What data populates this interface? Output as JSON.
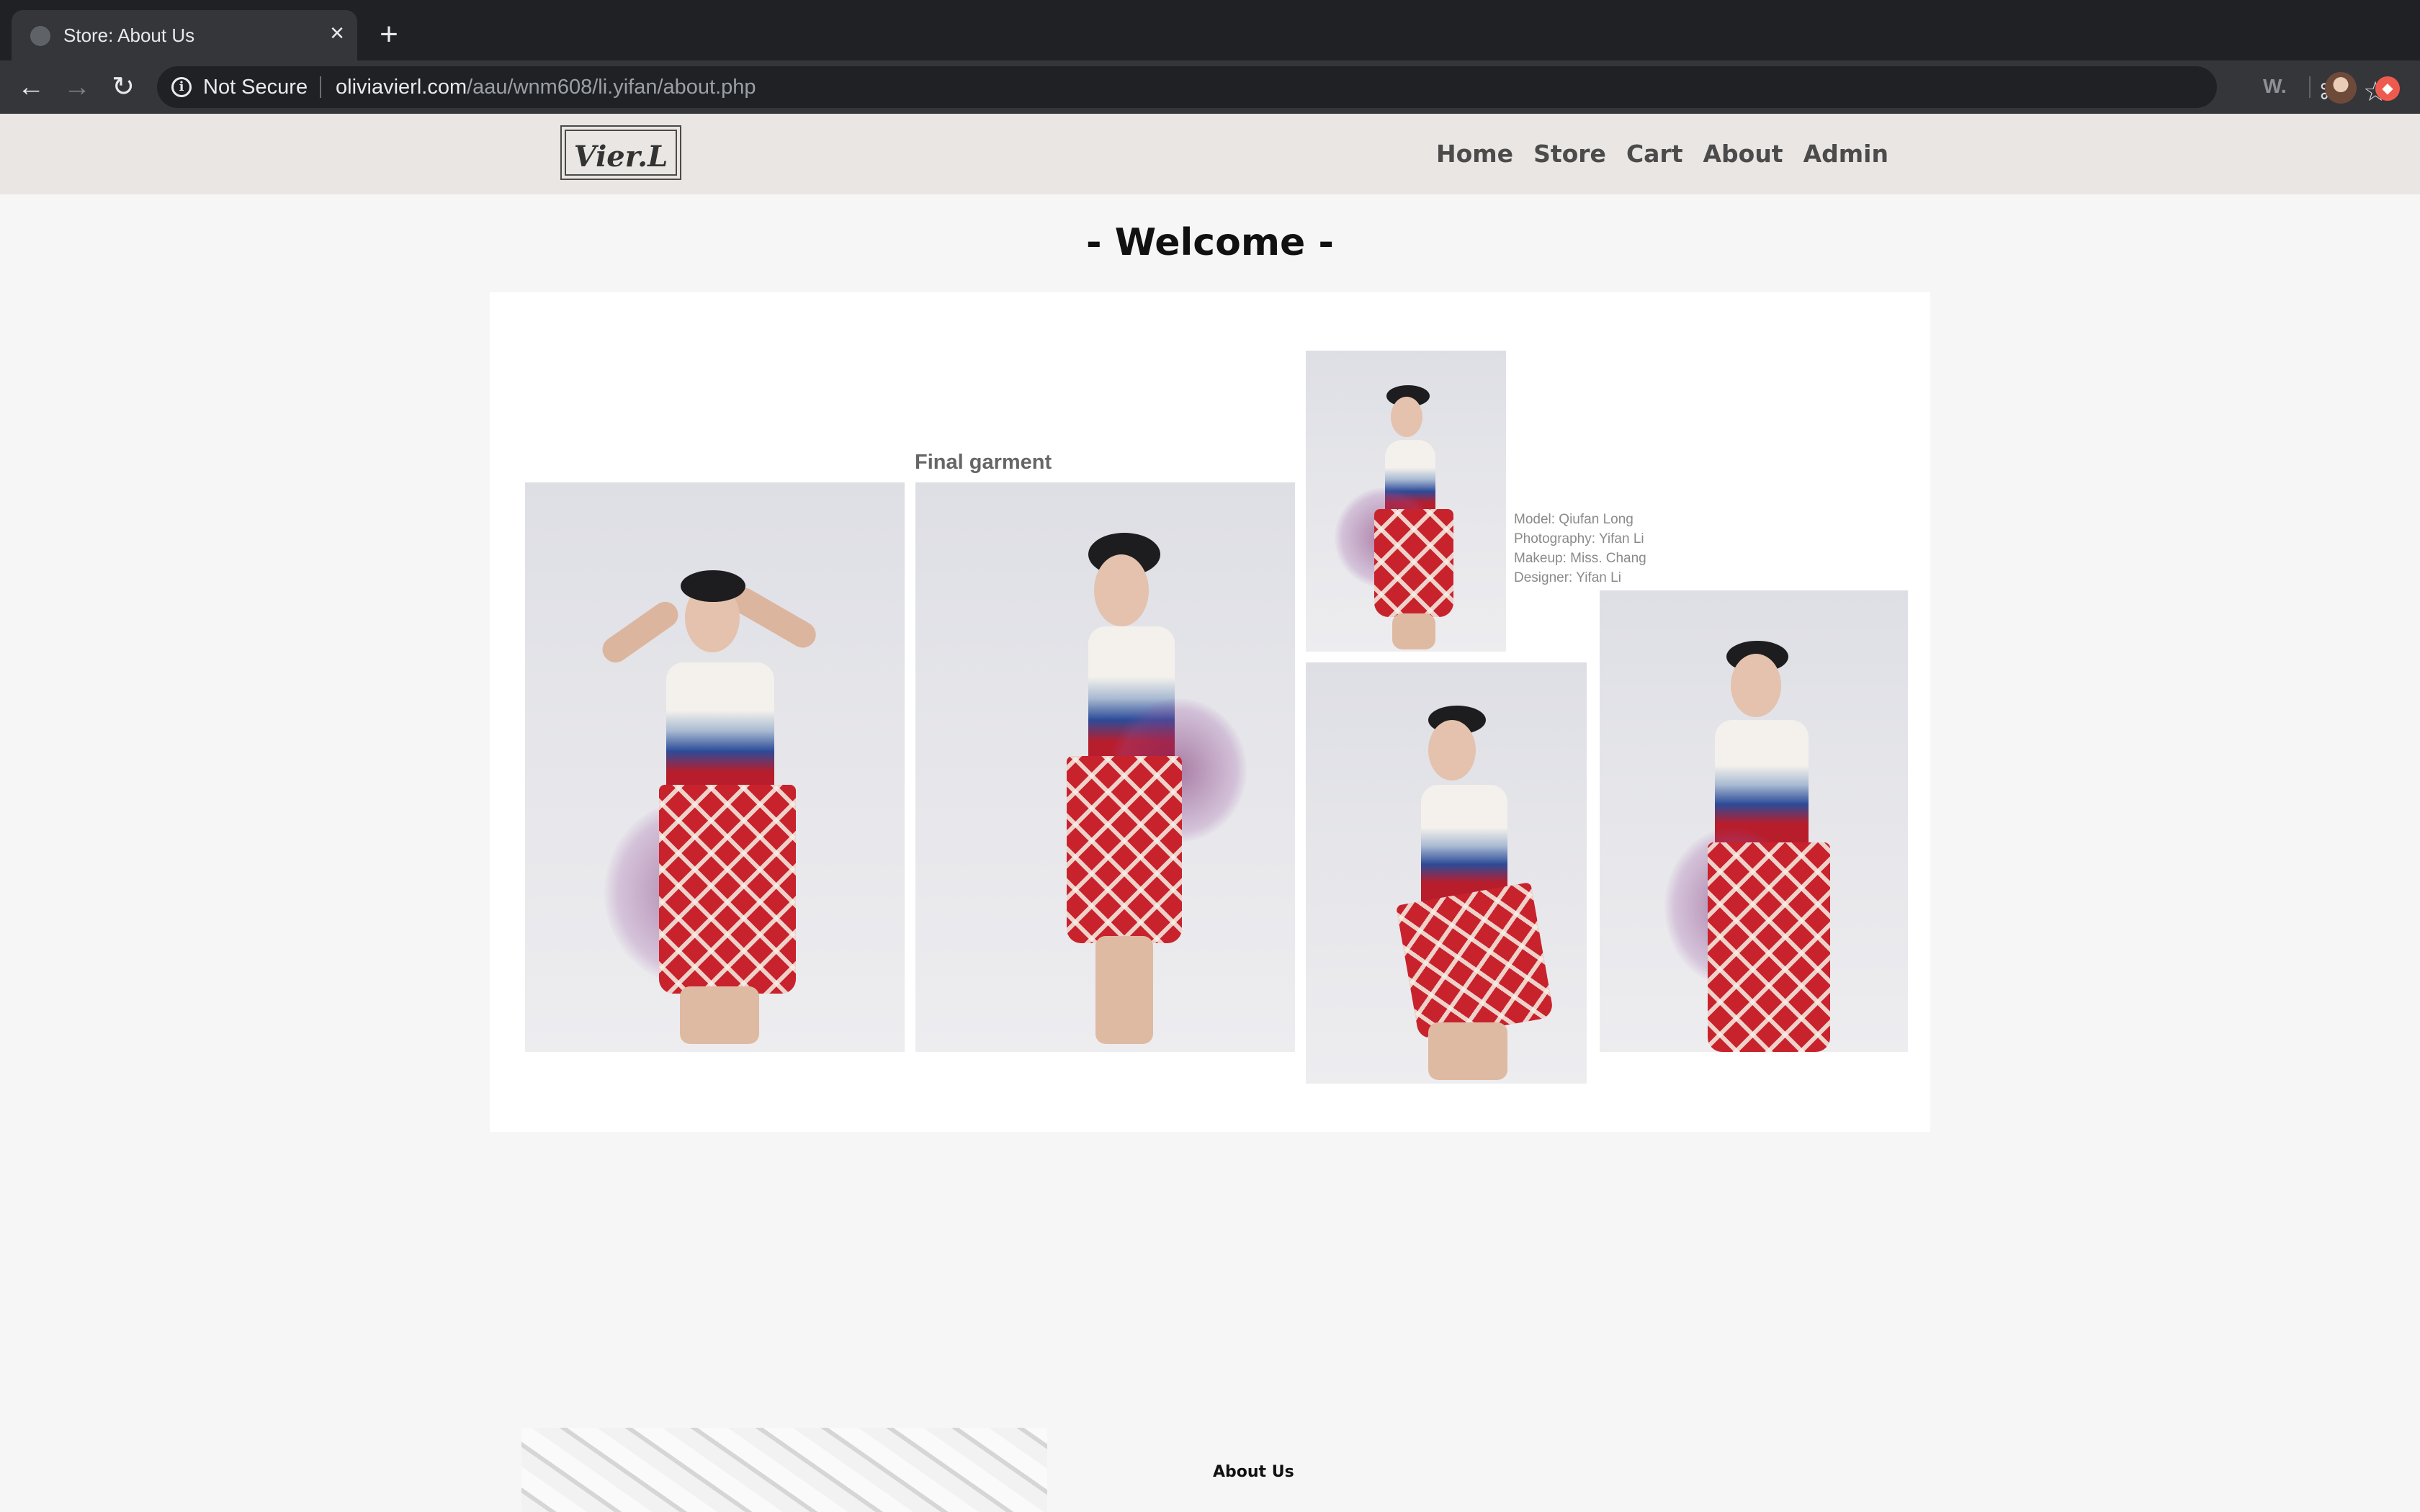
{
  "browser": {
    "tab_title": "Store: About Us",
    "tab_close_glyph": "×",
    "new_tab_glyph": "+",
    "security_label": "Not Secure",
    "url_host": "oliviavierl.com",
    "url_path": "/aau/wnm608/li.yifan/about.php",
    "extension_label": "W.",
    "icons": [
      "back-icon",
      "forward-icon",
      "reload-icon",
      "info-icon",
      "translate-icon",
      "star-icon",
      "profile-avatar",
      "extension-icon"
    ]
  },
  "site": {
    "logo_text": "Vier.L",
    "nav": [
      "Home",
      "Store",
      "Cart",
      "About",
      "Admin"
    ]
  },
  "page": {
    "welcome": "- Welcome -",
    "gallery_caption": "Final garment",
    "credits": [
      "Model: Qiufan Long",
      "Photography: Yifan Li",
      "Makeup: Miss. Chang",
      "Designer: Yifan Li"
    ],
    "about_heading": "About Us"
  },
  "colors": {
    "header_bg": "#e9e6e3",
    "page_bg": "#f6f6f6",
    "nav_text": "#4b4b4b",
    "garment_red": "#c8232d",
    "garment_blue": "#2c4b98"
  }
}
